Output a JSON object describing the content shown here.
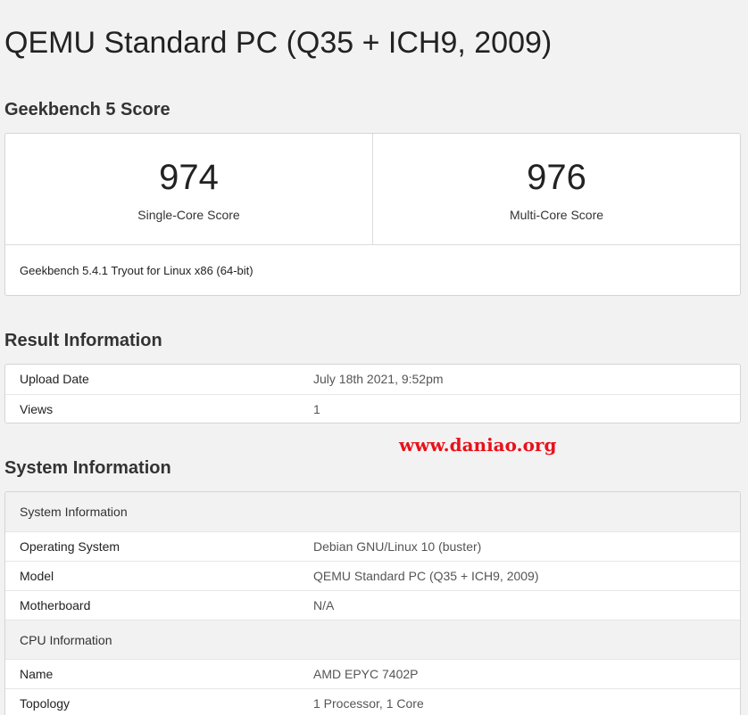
{
  "page_title": "QEMU Standard PC (Q35 + ICH9, 2009)",
  "geekbench": {
    "section_title": "Geekbench 5 Score",
    "single_core": {
      "value": "974",
      "label": "Single-Core Score"
    },
    "multi_core": {
      "value": "976",
      "label": "Multi-Core Score"
    },
    "version": "Geekbench 5.4.1 Tryout for Linux x86 (64-bit)"
  },
  "result": {
    "section_title": "Result Information",
    "rows": [
      {
        "key": "Upload Date",
        "value": "July 18th 2021, 9:52pm"
      },
      {
        "key": "Views",
        "value": "1"
      }
    ]
  },
  "watermark": "www.daniao.org",
  "system": {
    "section_title": "System Information",
    "groups": [
      {
        "title": "System Information",
        "rows": [
          {
            "key": "Operating System",
            "value": "Debian GNU/Linux 10 (buster)"
          },
          {
            "key": "Model",
            "value": "QEMU Standard PC (Q35 + ICH9, 2009)"
          },
          {
            "key": "Motherboard",
            "value": "N/A"
          }
        ]
      },
      {
        "title": "CPU Information",
        "rows": [
          {
            "key": "Name",
            "value": "AMD EPYC 7402P"
          },
          {
            "key": "Topology",
            "value": "1 Processor, 1 Core"
          }
        ]
      }
    ]
  }
}
